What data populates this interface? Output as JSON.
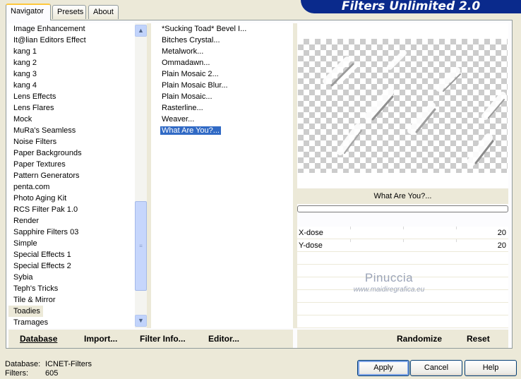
{
  "app": {
    "banner_title": "Filters Unlimited 2.0"
  },
  "tabs": [
    {
      "label": "Navigator",
      "active": true
    },
    {
      "label": "Presets",
      "active": false
    },
    {
      "label": "About",
      "active": false
    }
  ],
  "categories": {
    "items": [
      "Image Enhancement",
      "It@lian Editors Effect",
      "kang 1",
      "kang 2",
      "kang 3",
      "kang 4",
      "Lens Effects",
      "Lens Flares",
      "Mock",
      "MuRa's Seamless",
      "Noise Filters",
      "Paper Backgrounds",
      "Paper Textures",
      "Pattern Generators",
      "penta.com",
      "Photo Aging Kit",
      "RCS Filter Pak 1.0",
      "Render",
      "Sapphire Filters 03",
      "Simple",
      "Special Effects 1",
      "Special Effects 2",
      "Sybia",
      "Teph's Tricks",
      "Tile & Mirror",
      "Toadies",
      "Tramages"
    ],
    "selected": "Toadies"
  },
  "filters": {
    "items": [
      "*Sucking Toad*  Bevel I...",
      "Bitches Crystal...",
      "Metalwork...",
      "Ommadawn...",
      "Plain Mosaic 2...",
      "Plain Mosaic Blur...",
      "Plain Mosaic...",
      "Rasterline...",
      "Weaver...",
      "What Are You?..."
    ],
    "selected": "What Are You?..."
  },
  "preview": {
    "filter_name": "What Are You?..."
  },
  "params": [
    {
      "label": "X-dose",
      "value": "20"
    },
    {
      "label": "Y-dose",
      "value": "20"
    }
  ],
  "watermark": {
    "name": "Pinuccia",
    "url": "www.maidiregrafica.eu"
  },
  "toolbar_left": {
    "database": "Database",
    "import": "Import...",
    "filter_info": "Filter Info...",
    "editor": "Editor..."
  },
  "toolbar_right": {
    "randomize": "Randomize",
    "reset": "Reset"
  },
  "status": {
    "database_label": "Database:",
    "database_value": "ICNET-Filters",
    "filters_label": "Filters:",
    "filters_value": "605"
  },
  "buttons": {
    "apply": "Apply",
    "cancel": "Cancel",
    "help": "Help"
  },
  "colors": {
    "banner": "#0a2a8c",
    "selection": "#316ac5",
    "dialog_bg": "#ece9d8"
  }
}
